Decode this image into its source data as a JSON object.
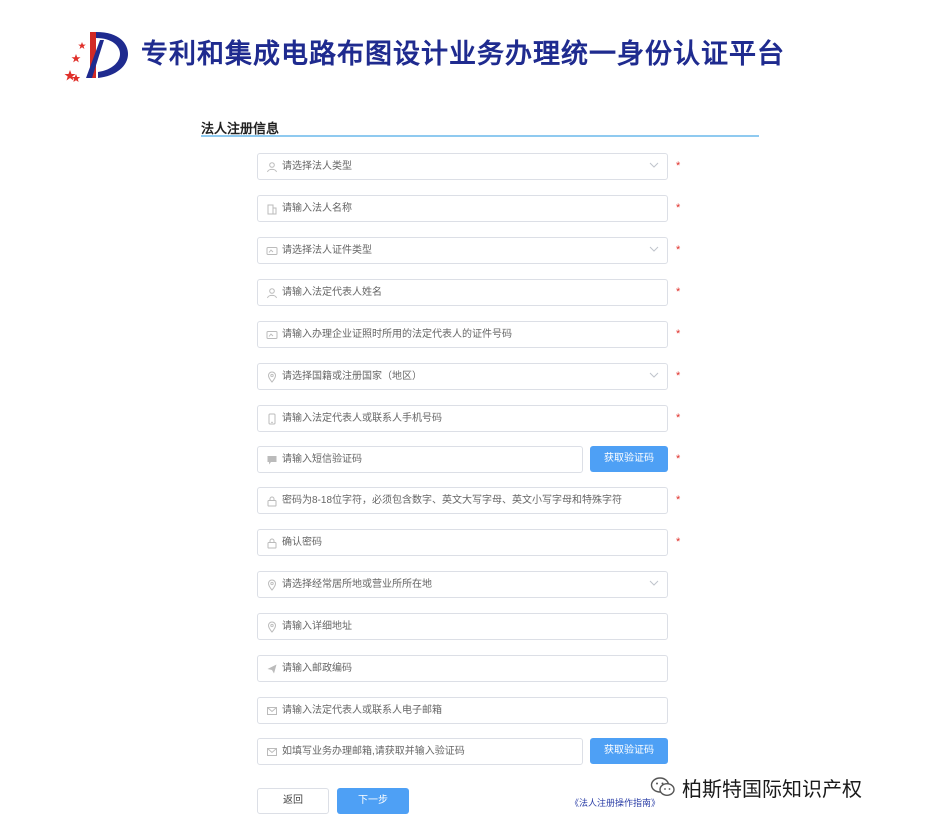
{
  "header": {
    "title": "专利和集成电路布图设计业务办理统一身份认证平台"
  },
  "section": {
    "title": "法人注册信息"
  },
  "colors": {
    "brand_blue": "#1f2b8f",
    "accent_blue": "#4ea0f5",
    "required_red": "#e0302a",
    "rule_blue": "#8fcaf0"
  },
  "form": {
    "required_mark": "*",
    "fields": [
      {
        "icon": "user-icon",
        "placeholder": "请选择法人类型",
        "type": "select",
        "required": true
      },
      {
        "icon": "building-icon",
        "placeholder": "请输入法人名称",
        "type": "input",
        "required": true
      },
      {
        "icon": "id-card-icon",
        "placeholder": "请选择法人证件类型",
        "type": "select",
        "required": true
      },
      {
        "icon": "user-icon",
        "placeholder": "请输入法定代表人姓名",
        "type": "input",
        "required": true
      },
      {
        "icon": "id-card-icon",
        "placeholder": "请输入办理企业证照时所用的法定代表人的证件号码",
        "type": "input",
        "required": true
      },
      {
        "icon": "location-icon",
        "placeholder": "请选择国籍或注册国家（地区）",
        "type": "select",
        "required": true
      },
      {
        "icon": "phone-icon",
        "placeholder": "请输入法定代表人或联系人手机号码",
        "type": "input",
        "required": true
      },
      {
        "icon": "message-icon",
        "placeholder": "请输入短信验证码",
        "type": "input-with-button",
        "required": true
      },
      {
        "icon": "lock-icon",
        "placeholder": "密码为8-18位字符，必须包含数字、英文大写字母、英文小写字母和特殊字符",
        "type": "input",
        "required": true
      },
      {
        "icon": "lock-icon",
        "placeholder": "确认密码",
        "type": "input",
        "required": true
      },
      {
        "icon": "location-icon",
        "placeholder": "请选择经常居所地或营业所所在地",
        "type": "select",
        "required": false
      },
      {
        "icon": "location-icon",
        "placeholder": "请输入详细地址",
        "type": "input",
        "required": false
      },
      {
        "icon": "send-icon",
        "placeholder": "请输入邮政编码",
        "type": "input",
        "required": false
      },
      {
        "icon": "mail-icon",
        "placeholder": "请输入法定代表人或联系人电子邮箱",
        "type": "input",
        "required": false
      },
      {
        "icon": "mail-icon",
        "placeholder": "如填写业务办理邮箱,请获取并输入验证码",
        "type": "input-with-button",
        "required": false
      }
    ],
    "sms_code_button": "获取验证码",
    "email_code_button": "获取验证码"
  },
  "actions": {
    "back_label": "返回",
    "next_label": "下一步",
    "guide_link": "《法人注册操作指南》"
  },
  "watermark": {
    "text": "柏斯特国际知识产权",
    "icon": "wechat-icon"
  }
}
